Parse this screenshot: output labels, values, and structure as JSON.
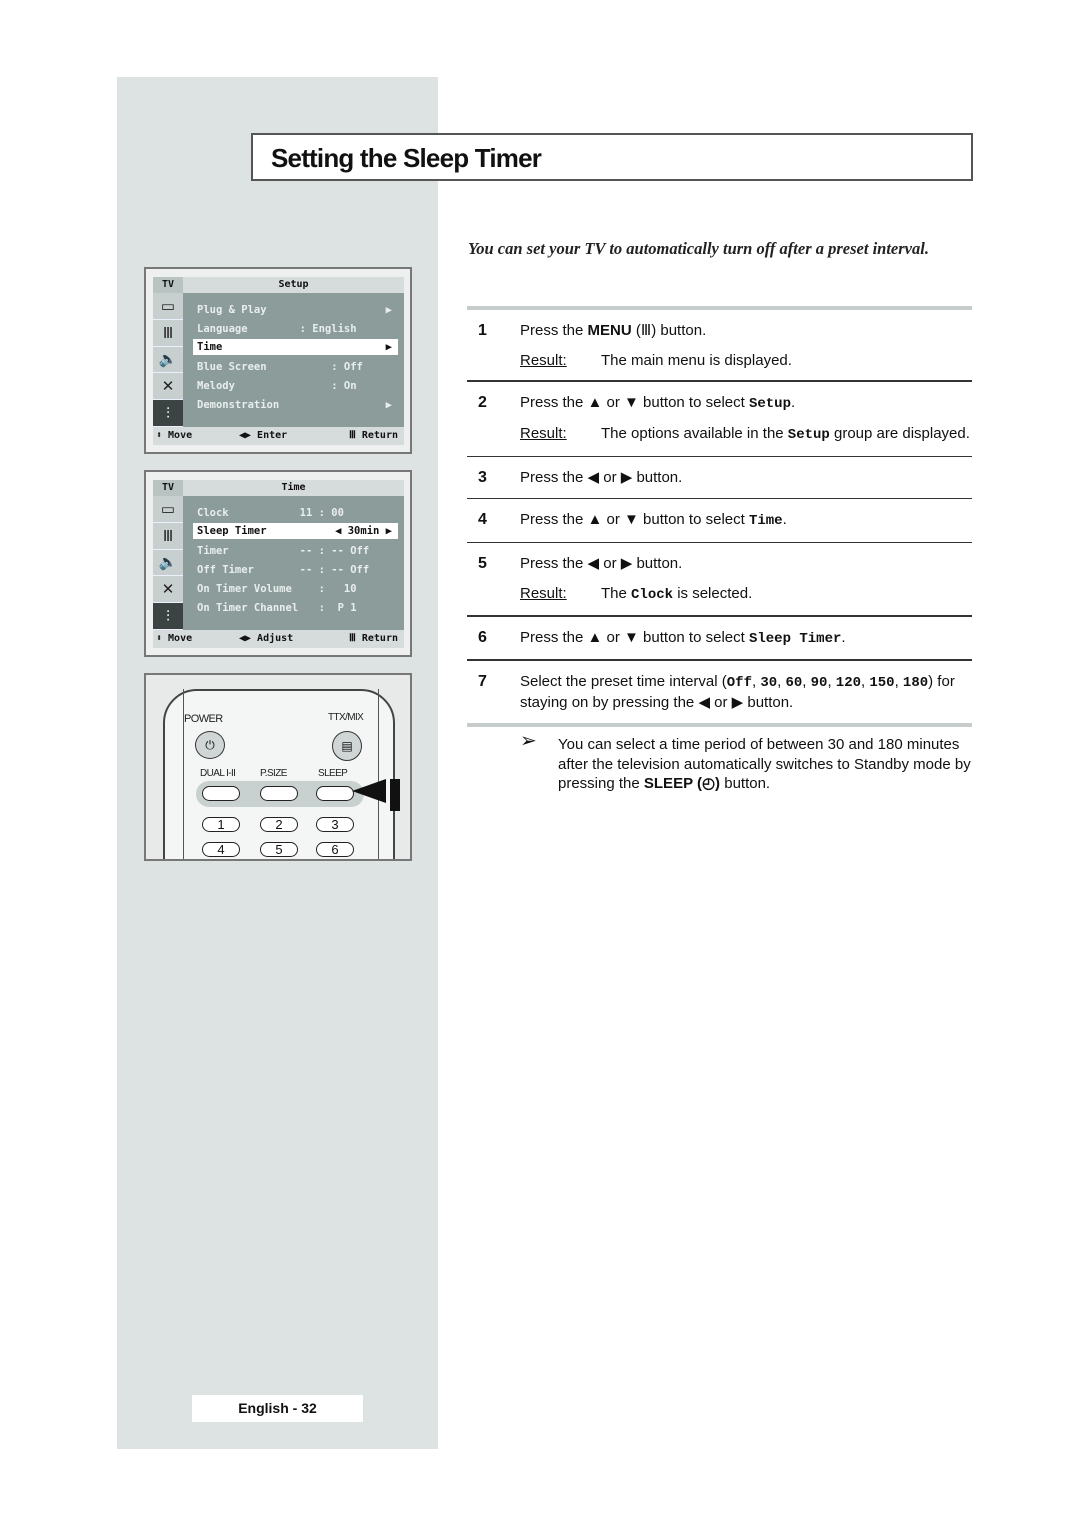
{
  "title": "Setting the Sleep Timer",
  "intro": "You can set your TV to automatically turn off after a preset interval.",
  "osd_setup": {
    "tv": "TV",
    "title": "Setup",
    "icons": [
      "input-icon",
      "picture-icon",
      "sound-icon",
      "channel-icon",
      "setup-icon"
    ],
    "rows": [
      {
        "label": "Plug & Play",
        "value": "",
        "arrow": "▶"
      },
      {
        "label": "Language",
        "value": "  : English",
        "arrow": ""
      },
      {
        "label": "Time",
        "value": "",
        "arrow": "▶",
        "selected": true
      },
      {
        "label": "Blue Screen",
        "value": "       : Off",
        "arrow": ""
      },
      {
        "label": "Melody",
        "value": "       : On",
        "arrow": ""
      },
      {
        "label": "Demonstration",
        "value": "",
        "arrow": "▶"
      }
    ],
    "footer": {
      "move": "⬍ Move",
      "action": "◀▶ Enter",
      "return": "Ⅲ Return"
    }
  },
  "osd_time": {
    "tv": "TV",
    "title": "Time",
    "rows": [
      {
        "label": "Clock",
        "value": "  11 : 00",
        "arrow": ""
      },
      {
        "label": "Sleep Timer",
        "value": "",
        "arrow": "◀ 30min ▶",
        "selected": true
      },
      {
        "label": "Timer",
        "value": "  -- : -- Off",
        "arrow": ""
      },
      {
        "label": "Off Timer",
        "value": "  -- : -- Off",
        "arrow": ""
      },
      {
        "label": "On Timer Volume",
        "value": "     :   10",
        "arrow": ""
      },
      {
        "label": "On Timer Channel",
        "value": "     :  P 1",
        "arrow": ""
      }
    ],
    "footer": {
      "move": "⬍ Move",
      "action": "◀▶ Adjust",
      "return": "Ⅲ Return"
    }
  },
  "remote": {
    "power": "POWER",
    "ttx": "TTX/MIX",
    "dual": "DUAL I-II",
    "psize": "P.SIZE",
    "sleep": "SLEEP",
    "numbers": [
      "1",
      "2",
      "3",
      "4",
      "5",
      "6"
    ]
  },
  "steps": [
    {
      "num": "1",
      "text": [
        [
          "Press the "
        ],
        [
          "MENU",
          "b"
        ],
        [
          " (Ⅲ) button."
        ]
      ],
      "result": [
        [
          "The main menu is displayed."
        ]
      ]
    },
    {
      "num": "2",
      "text": [
        [
          "Press the ▲ or ▼ button to select "
        ],
        [
          "Setup",
          "m"
        ],
        [
          "."
        ]
      ],
      "result": [
        [
          "The options available in the "
        ],
        [
          "Setup",
          "m"
        ],
        [
          " group are displayed."
        ]
      ]
    },
    {
      "num": "3",
      "text": [
        [
          "Press the ◀ or ▶ button."
        ]
      ]
    },
    {
      "num": "4",
      "text": [
        [
          "Press the ▲ or ▼ button to select "
        ],
        [
          "Time",
          "m"
        ],
        [
          "."
        ]
      ]
    },
    {
      "num": "5",
      "text": [
        [
          "Press the ◀ or ▶ button."
        ]
      ],
      "result": [
        [
          "The "
        ],
        [
          "Clock",
          "m"
        ],
        [
          " is selected."
        ]
      ]
    },
    {
      "num": "6",
      "text": [
        [
          "Press the ▲ or ▼ button to select "
        ],
        [
          "Sleep Timer",
          "m"
        ],
        [
          "."
        ]
      ]
    },
    {
      "num": "7",
      "text": [
        [
          "Select the preset time interval ("
        ],
        [
          "Off",
          "m"
        ],
        [
          ", "
        ],
        [
          "30",
          "m"
        ],
        [
          ", "
        ],
        [
          "60",
          "m"
        ],
        [
          ", "
        ],
        [
          "90",
          "m"
        ],
        [
          ", "
        ],
        [
          "120",
          "m"
        ],
        [
          ", "
        ],
        [
          "150",
          "m"
        ],
        [
          ", "
        ],
        [
          "180",
          "m"
        ],
        [
          ") for staying on by pressing the ◀ or ▶ button."
        ]
      ]
    }
  ],
  "result_label": "Result:",
  "note": [
    [
      "You can select a time period of between 30 and 180 minutes after the television automatically switches to Standby mode by pressing the "
    ],
    [
      "SLEEP (◴)",
      "b"
    ],
    [
      " button."
    ]
  ],
  "footer": "English - 32"
}
